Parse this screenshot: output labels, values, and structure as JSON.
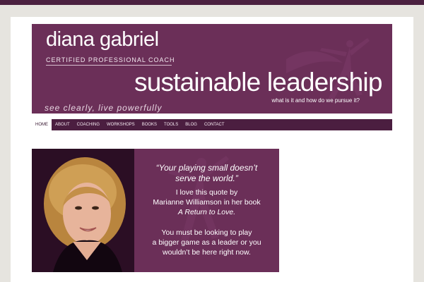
{
  "brand": {
    "name": "diana gabriel",
    "subtitle": "CERTIFIED PROFESSIONAL COACH",
    "tagline": "see clearly, live powerfully"
  },
  "banner": {
    "headline": "sustainable leadership",
    "subheadline": "what is it and how do we pursue it?"
  },
  "nav": {
    "items": [
      "HOME",
      "ABOUT",
      "COACHING",
      "WORKSHOPS",
      "BOOKS",
      "TOOLS",
      "BLOG",
      "CONTACT"
    ],
    "active": "HOME"
  },
  "feature": {
    "quote_line1": "“Your playing small doesn’t",
    "quote_line2": "serve the world.”",
    "p1_line1": "I love this quote by",
    "p1_line2": "Marianne Williamson in her book",
    "p1_line3": "A Return to Love.",
    "p2_line1": "You must be looking to play",
    "p2_line2": "a bigger game as a leader or you",
    "p2_line3": "wouldn’t be here right now."
  },
  "colors": {
    "brand_plum": "#6b2f58",
    "nav_dark": "#4b1e40",
    "page_bg": "#e6e4df"
  }
}
